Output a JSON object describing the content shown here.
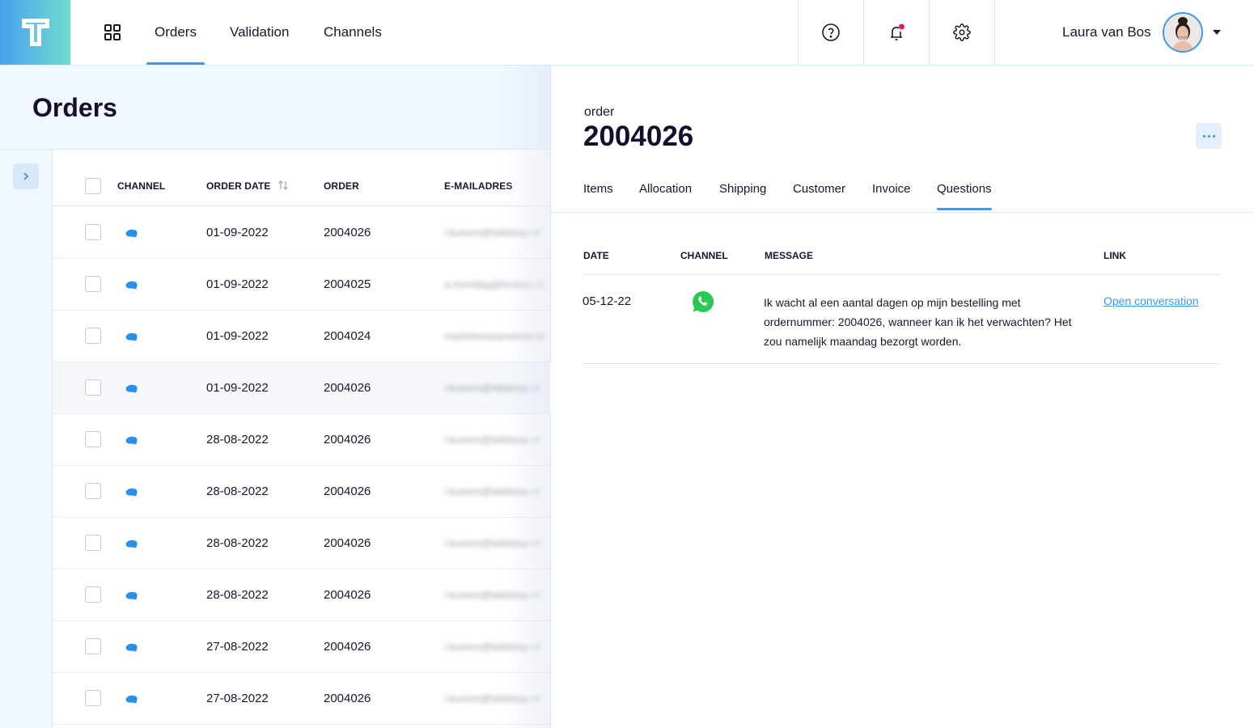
{
  "app": {
    "logo_letter": "T",
    "brand_gradient": [
      "#4aa0ef",
      "#6fdccf"
    ],
    "accent_color": "#3a97ea"
  },
  "topnav": {
    "apps_icon": "grid-icon",
    "tabs": [
      {
        "label": "Orders",
        "active": true
      },
      {
        "label": "Validation",
        "active": false
      },
      {
        "label": "Channels",
        "active": false
      }
    ],
    "icons": [
      {
        "name": "help-icon"
      },
      {
        "name": "bell-icon",
        "has_notification": true,
        "notification_color": "#e5146b"
      },
      {
        "name": "gear-icon"
      }
    ],
    "user": {
      "name": "Laura van Bos",
      "avatar": "user-avatar"
    }
  },
  "orders_panel": {
    "title": "Orders",
    "columns": [
      "CHANNEL",
      "ORDER DATE",
      "ORDER",
      "E-MAILADRES"
    ],
    "sort_icon": "sort-icon",
    "rows": [
      {
        "channel": "shopware",
        "date": "01-09-2022",
        "order": "2004026",
        "email": "l.kuners@tabletop.nl",
        "highlighted": false
      },
      {
        "channel": "shopware",
        "date": "01-09-2022",
        "order": "2004025",
        "email": "a.mendag@kvarus.nl",
        "highlighted": false
      },
      {
        "channel": "shopware",
        "date": "01-09-2022",
        "order": "2004024",
        "email": "marieleenaarwestenb",
        "highlighted": false
      },
      {
        "channel": "shopware",
        "date": "01-09-2022",
        "order": "2004026",
        "email": "l.kuners@tabletop.nl",
        "highlighted": true
      },
      {
        "channel": "shopware",
        "date": "28-08-2022",
        "order": "2004026",
        "email": "l.kuners@tabletop.nl",
        "highlighted": false
      },
      {
        "channel": "shopware",
        "date": "28-08-2022",
        "order": "2004026",
        "email": "l.kuners@tabletop.nl",
        "highlighted": false
      },
      {
        "channel": "shopware",
        "date": "28-08-2022",
        "order": "2004026",
        "email": "l.kuners@tabletop.nl",
        "highlighted": false
      },
      {
        "channel": "shopware",
        "date": "28-08-2022",
        "order": "2004026",
        "email": "l.kuners@tabletop.nl",
        "highlighted": false
      },
      {
        "channel": "shopware",
        "date": "27-08-2022",
        "order": "2004026",
        "email": "l.kuners@tabletop.nl",
        "highlighted": false
      },
      {
        "channel": "shopware",
        "date": "27-08-2022",
        "order": "2004026",
        "email": "l.kuners@tabletop.nl",
        "highlighted": false
      }
    ]
  },
  "detail": {
    "label": "order",
    "order_number": "2004026",
    "tabs": [
      {
        "label": "Items",
        "active": false
      },
      {
        "label": "Allocation",
        "active": false
      },
      {
        "label": "Shipping",
        "active": false
      },
      {
        "label": "Customer",
        "active": false
      },
      {
        "label": "Invoice",
        "active": false
      },
      {
        "label": "Questions",
        "active": true
      }
    ],
    "questions": {
      "columns": [
        "DATE",
        "CHANNEL",
        "MESSAGE",
        "LINK"
      ],
      "rows": [
        {
          "date": "05-12-22",
          "channel": "whatsapp",
          "message": "Ik wacht al een aantal dagen op mijn bestelling met ordernummer: 2004026, wanneer kan ik het verwachten? Het zou namelijk maandag bezorgt worden.",
          "link": "Open conversation"
        }
      ]
    }
  }
}
